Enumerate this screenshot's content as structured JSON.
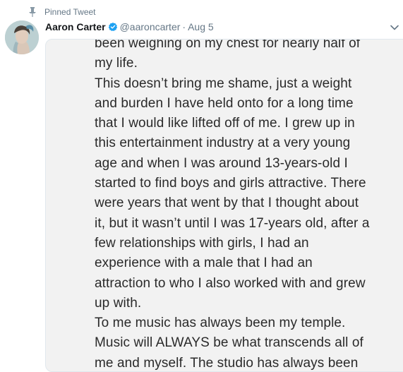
{
  "pinned": {
    "label": "Pinned Tweet",
    "icon": "pin-icon"
  },
  "author": {
    "name": "Aaron Carter",
    "handle": "@aaroncarter",
    "separator": "·",
    "date": "Aug 5",
    "verified_icon": "verified-badge-icon",
    "avatar": "avatar"
  },
  "menu_icon": "chevron-down-icon",
  "note": {
    "lines": [
      "been weighing on my chest for nearly half of",
      "my life.",
      "This doesn’t bring me shame, just a weight",
      "and burden I have held onto for a long time",
      "that I would like lifted off of me. I grew up in",
      "this entertainment industry at a very young",
      "age and when I was around 13-years-old I",
      "started to find boys and girls attractive. There",
      "were years that went by that I thought about",
      "it, but it wasn’t until I was 17-years old, after a",
      "few relationships with girls, I had an",
      "experience with a male that I had an",
      "attraction to who I also worked with and grew",
      "up with.",
      "To me music has always been my temple.",
      "Music will ALWAYS be what transcends all of",
      "me and myself. The studio has always been"
    ]
  },
  "colors": {
    "text_primary": "#14171a",
    "text_secondary": "#657786",
    "verified": "#1da1f2",
    "border": "#e1e8ed",
    "note_background": "#f2f2f2"
  }
}
